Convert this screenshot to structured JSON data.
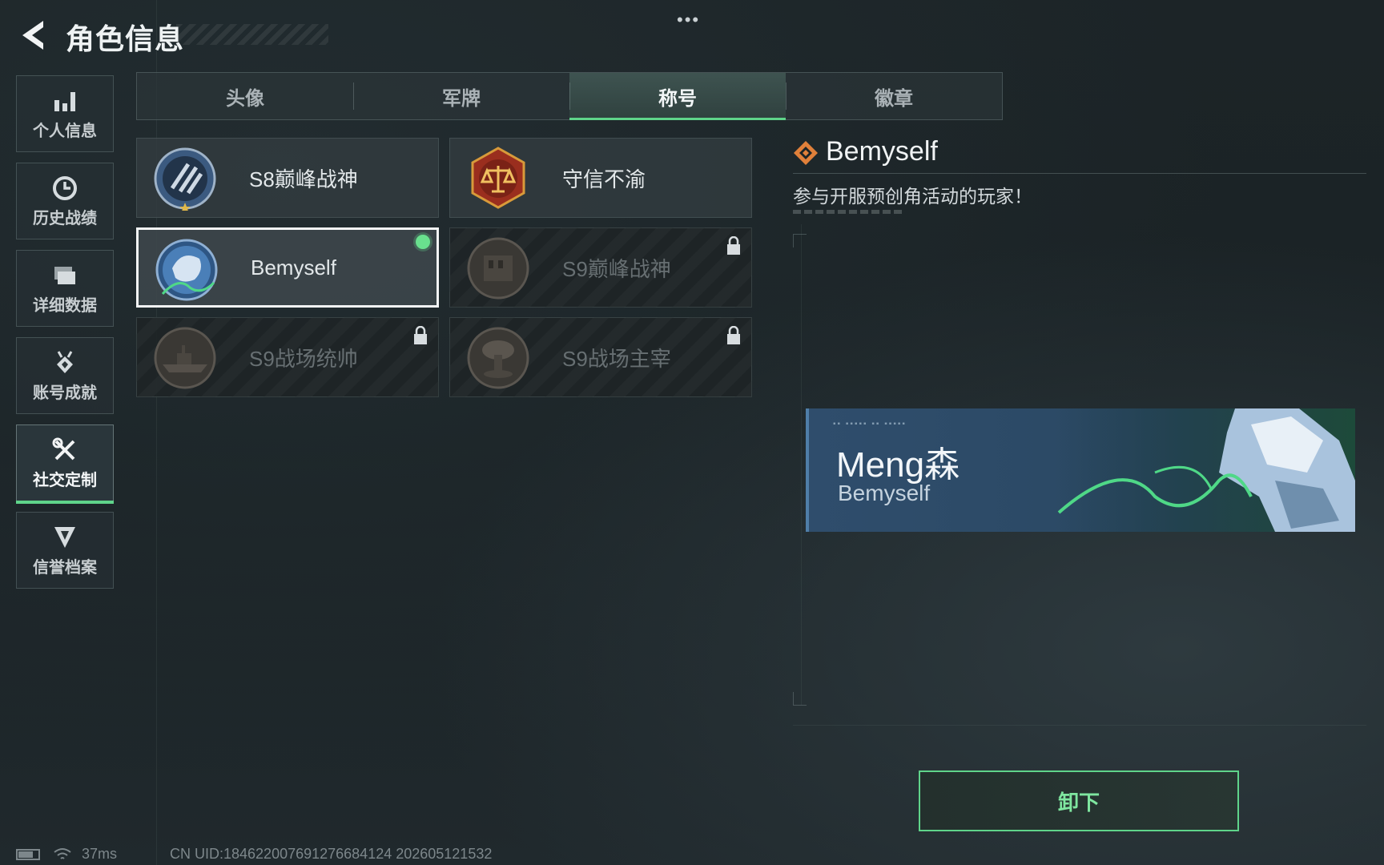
{
  "header": {
    "title": "角色信息",
    "more_dots": "•••"
  },
  "sidebar": {
    "items": [
      {
        "label": "个人信息",
        "icon": "bar-chart-icon"
      },
      {
        "label": "历史战绩",
        "icon": "clock-icon"
      },
      {
        "label": "详细数据",
        "icon": "folder-icon"
      },
      {
        "label": "账号成就",
        "icon": "medal-icon"
      },
      {
        "label": "社交定制",
        "icon": "tools-icon",
        "active": true
      },
      {
        "label": "信誉档案",
        "icon": "shield-badge-icon"
      }
    ]
  },
  "tabs": [
    {
      "label": "头像"
    },
    {
      "label": "军牌"
    },
    {
      "label": "称号",
      "active": true
    },
    {
      "label": "徽章"
    }
  ],
  "titles": [
    {
      "name": "S8巅峰战神",
      "locked": false,
      "badge": "s8-peak-badge-icon"
    },
    {
      "name": "守信不渝",
      "locked": false,
      "badge": "scales-badge-icon"
    },
    {
      "name": "Bemyself",
      "locked": false,
      "selected": true,
      "equipped": true,
      "badge": "bemyself-badge-icon"
    },
    {
      "name": "S9巅峰战神",
      "locked": true,
      "badge": "s9-peak-badge-icon"
    },
    {
      "name": "S9战场统帅",
      "locked": true,
      "badge": "battleship-badge-icon"
    },
    {
      "name": "S9战场主宰",
      "locked": true,
      "badge": "mushroom-cloud-badge-icon"
    }
  ],
  "detail": {
    "title": "Bemyself",
    "description": "参与开服预创角活动的玩家！",
    "banner": {
      "nickname": "Meng森",
      "title": "Bemyself"
    }
  },
  "actions": {
    "unequip_label": "卸下"
  },
  "status": {
    "ping": "37ms",
    "uid": "CN UID:1846220076912766841​24 202605121532"
  },
  "colors": {
    "accent": "#5fd48a",
    "background": "#1c2427",
    "banner": "#2f4d6c"
  }
}
